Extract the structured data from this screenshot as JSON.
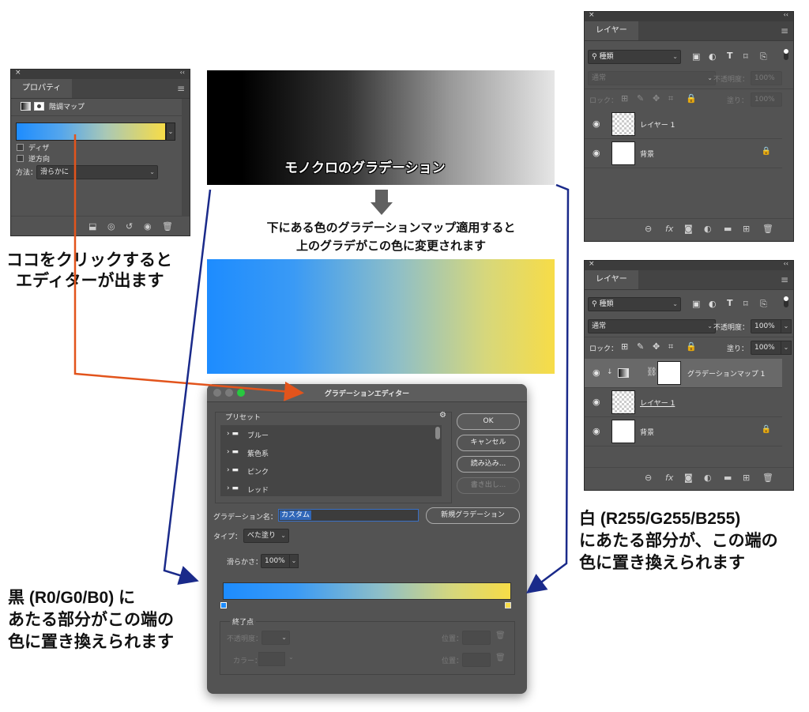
{
  "properties_panel": {
    "close": "×",
    "collapse": "‹‹",
    "tab": "プロパティ",
    "menu": "≡",
    "title": "階調マップ",
    "icons": [
      "adjustment-icon",
      "mask-icon"
    ],
    "dither_label": "ディザ",
    "reverse_label": "逆方向",
    "method_label": "方法：",
    "method_value": "滑らかに",
    "gradient_colors": [
      "#1d8cff",
      "#f7dc47"
    ],
    "footer_icons": [
      "clip-icon",
      "visibility-prev-icon",
      "reset-icon",
      "eye-icon",
      "trash-icon"
    ]
  },
  "mono_gradient_caption": "モノクロのグラデーション",
  "middle_caption": {
    "line1": "下にある色のグラデーションマップ適用すると",
    "line2": "上のグラデがこの色に変更されます"
  },
  "annotations": {
    "click_hint_1": "ココをクリックすると",
    "click_hint_2": "エディターが出ます",
    "black_1": "黒 (R0/G0/B0) に",
    "black_2": "あたる部分がこの端の",
    "black_3": "色に置き換えられます",
    "white_1": "白 (R255/G255/B255)",
    "white_2": "にあたる部分が、この端の",
    "white_3": "色に置き換えられます"
  },
  "layers_panel_1": {
    "tab": "レイヤー",
    "kind_label": "種類",
    "blend_mode": "通常",
    "opacity_label": "不透明度：",
    "opacity_value": "100%",
    "lock_label": "ロック：",
    "fill_label": "塗り：",
    "fill_value": "100%",
    "layers": [
      {
        "name": "レイヤー 1"
      },
      {
        "name": "背景"
      }
    ]
  },
  "layers_panel_2": {
    "tab": "レイヤー",
    "kind_label": "種類",
    "blend_mode": "通常",
    "opacity_label": "不透明度：",
    "opacity_value": "100%",
    "lock_label": "ロック：",
    "fill_label": "塗り：",
    "fill_value": "100%",
    "layers": [
      {
        "name": "グラデーションマップ 1"
      },
      {
        "name": "レイヤー 1"
      },
      {
        "name": "背景"
      }
    ]
  },
  "gradient_editor": {
    "title": "グラデーションエディター",
    "presets_label": "プリセット",
    "presets": [
      "ブルー",
      "紫色系",
      "ピンク",
      "レッド"
    ],
    "ok": "OK",
    "cancel": "キャンセル",
    "load": "読み込み...",
    "save": "書き出し...",
    "name_label": "グラデーション名：",
    "name_value": "カスタム",
    "new_button": "新規グラデーション",
    "type_label": "タイプ：",
    "type_value": "べた塗り",
    "smooth_label": "滑らかさ：",
    "smooth_value": "100%",
    "stops_label": "終了点",
    "opacity_label": "不透明度：",
    "color_label": "カラー：",
    "location_label": "位置：",
    "colors": {
      "start": "#1d8cff",
      "end": "#f7dc47"
    }
  },
  "colors": {
    "panel_bg": "#535353",
    "arrow_orange": "#e2541c",
    "arrow_navy": "#1a2a8a"
  }
}
